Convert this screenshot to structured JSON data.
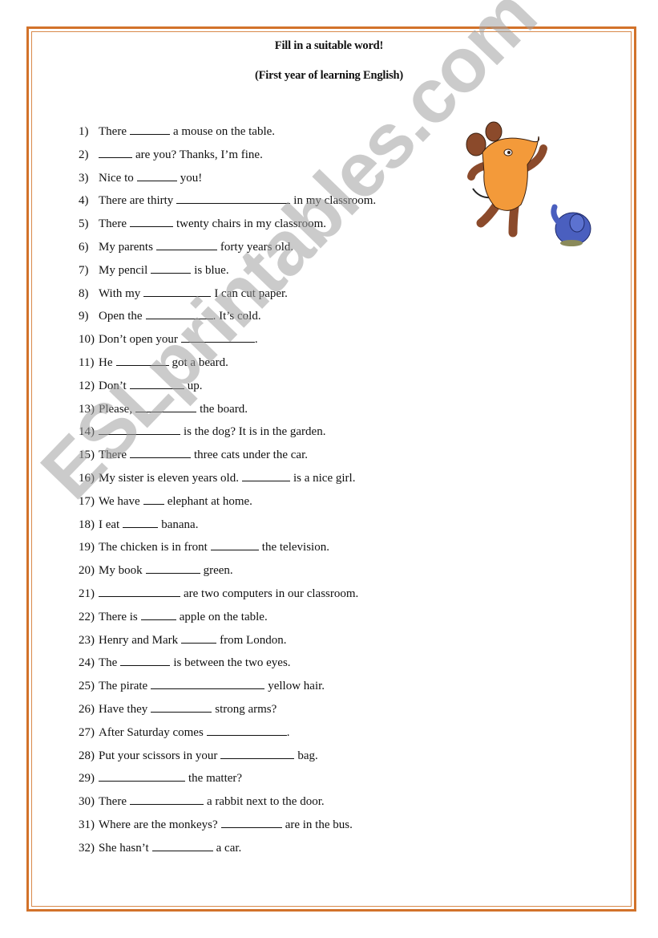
{
  "document": {
    "title": "Fill in a suitable word!",
    "subtitle": "(First year of learning English)",
    "watermark": "ESLprintables.com",
    "colors": {
      "border": "#d2722a",
      "mouse_body": "#f39a3a",
      "mouse_limbs": "#8b4a2b",
      "elephant": "#4a5fbf"
    },
    "illustration": "mouse-and-elephant-cartoon",
    "items": [
      {
        "num": "1)",
        "parts": [
          "There",
          "a mouse on the table."
        ],
        "blank_width": 50
      },
      {
        "num": "2)",
        "parts": [
          "",
          "are you? Thanks, I’m fine."
        ],
        "blank_width": 42
      },
      {
        "num": "3)",
        "parts": [
          "Nice to",
          "you!"
        ],
        "blank_width": 50
      },
      {
        "num": "4)",
        "parts": [
          "There are thirty",
          "in my classroom."
        ],
        "blank_width": 142
      },
      {
        "num": "5)",
        "parts": [
          "There",
          "twenty chairs in my classroom."
        ],
        "blank_width": 54
      },
      {
        "num": "6)",
        "parts": [
          "My parents",
          "forty years old."
        ],
        "blank_width": 76
      },
      {
        "num": "7)",
        "parts": [
          "My pencil",
          "is blue."
        ],
        "blank_width": 50
      },
      {
        "num": "8)",
        "parts": [
          "With my",
          "I can cut paper."
        ],
        "blank_width": 84
      },
      {
        "num": "9)",
        "parts": [
          "Open the",
          ". It’s cold."
        ],
        "blank_width": 84
      },
      {
        "num": "10)",
        "parts": [
          "Don’t open your",
          "."
        ],
        "blank_width": 92
      },
      {
        "num": "11)",
        "parts": [
          "He",
          "got a beard."
        ],
        "blank_width": 66
      },
      {
        "num": "12)",
        "parts": [
          "Don’t",
          "up."
        ],
        "blank_width": 68
      },
      {
        "num": "13)",
        "parts": [
          "Please,",
          "the board."
        ],
        "blank_width": 76
      },
      {
        "num": "14)",
        "parts": [
          "",
          "is the dog? It is in the garden."
        ],
        "blank_width": 102
      },
      {
        "num": "15)",
        "parts": [
          "There",
          "three cats under the car."
        ],
        "blank_width": 76
      },
      {
        "num": "16)",
        "parts": [
          "My sister is eleven years old.",
          "is a nice girl."
        ],
        "blank_width": 60
      },
      {
        "num": "17)",
        "parts": [
          "We have",
          "elephant at home."
        ],
        "blank_width": 26
      },
      {
        "num": "18)",
        "parts": [
          "I eat",
          "banana."
        ],
        "blank_width": 44
      },
      {
        "num": "19)",
        "parts": [
          "The chicken is in front",
          "the television."
        ],
        "blank_width": 60
      },
      {
        "num": "20)",
        "parts": [
          "My book",
          "green."
        ],
        "blank_width": 68
      },
      {
        "num": "21)",
        "parts": [
          "",
          "are two computers in our classroom."
        ],
        "blank_width": 102
      },
      {
        "num": "22)",
        "parts": [
          "There is",
          "apple on the table."
        ],
        "blank_width": 44
      },
      {
        "num": "23)",
        "parts": [
          "Henry and Mark",
          "from London."
        ],
        "blank_width": 44
      },
      {
        "num": "24)",
        "parts": [
          "The",
          "is between the two eyes."
        ],
        "blank_width": 62
      },
      {
        "num": "25)",
        "parts": [
          "The pirate",
          "yellow hair."
        ],
        "blank_width": 142
      },
      {
        "num": "26)",
        "parts": [
          "Have they",
          "strong arms?"
        ],
        "blank_width": 76
      },
      {
        "num": "27)",
        "parts": [
          "After Saturday comes",
          "."
        ],
        "blank_width": 100
      },
      {
        "num": "28)",
        "parts": [
          "Put your scissors in your",
          "bag."
        ],
        "blank_width": 92
      },
      {
        "num": "29)",
        "parts": [
          "",
          "the matter?"
        ],
        "blank_width": 108
      },
      {
        "num": "30)",
        "parts": [
          "There",
          "a rabbit next to the door."
        ],
        "blank_width": 92
      },
      {
        "num": "31)",
        "parts": [
          "Where are the monkeys?",
          "are in the bus."
        ],
        "blank_width": 76
      },
      {
        "num": "32)",
        "parts": [
          "She hasn’t",
          "a car."
        ],
        "blank_width": 76
      }
    ]
  }
}
